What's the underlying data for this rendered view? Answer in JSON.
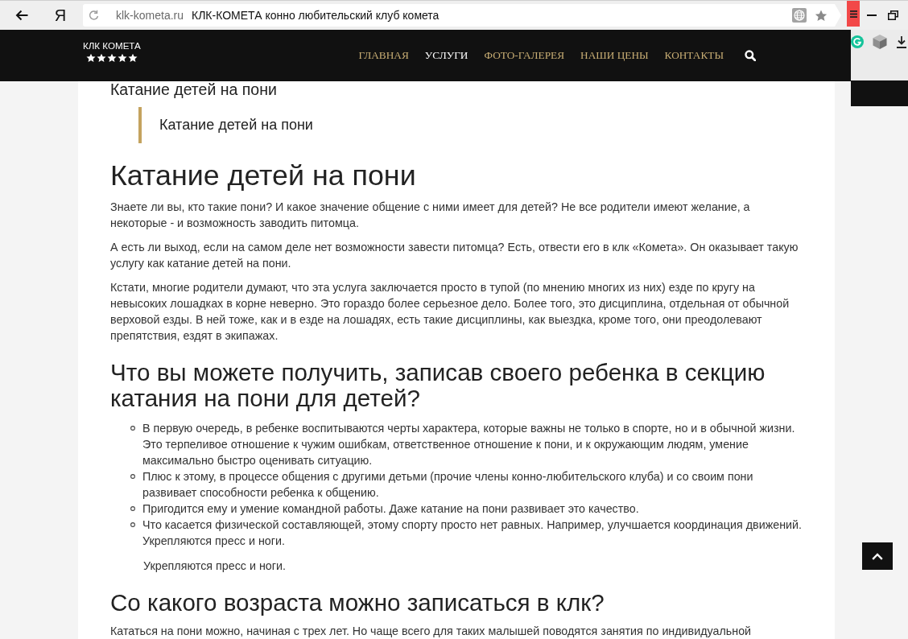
{
  "browser": {
    "logo": "Я",
    "domain": "klk-kometa.ru",
    "page_title": "КЛК-КОМЕТА конно любительский клуб комета"
  },
  "site_header": {
    "logo": {
      "name": "КЛК КОМЕТА",
      "stars": 5
    },
    "menu": [
      {
        "label": "ГЛАВНАЯ",
        "selected": false
      },
      {
        "label": "УСЛУГИ",
        "selected": true
      },
      {
        "label": "ФОТО-ГАЛЕРЕЯ",
        "selected": false
      },
      {
        "label": "НАШИ ЦЕНЫ",
        "selected": false
      },
      {
        "label": "КОНТАКТЫ",
        "selected": false
      }
    ]
  },
  "article": [
    {
      "kind": "subtitle",
      "text": "Катание детей на пони"
    },
    {
      "kind": "quote",
      "text": "Катание детей на пони"
    },
    {
      "kind": "title",
      "text": "Катание детей на пони"
    },
    {
      "kind": "paragraph",
      "text": "Знаете ли вы, кто такие пони? И какое значение общение с ними имеет для детей? Не все родители имеют желание, а некоторые - и возможность заводить питомца."
    },
    {
      "kind": "paragraph",
      "text": "А есть ли выход, если на самом деле нет возможности завести питомца? Есть, отвести его в клк «Комета». Он оказывает такую услугу как катание детей на пони."
    },
    {
      "kind": "paragraph",
      "text": "Кстати, многие родители думают, что эта услуга заключается просто в тупой (по мнению многих из них) езде по кругу на невысоких лошадках в корне неверно. Это гораздо более серьезное дело. Более того, это дисциплина, отдельная от обычной верховой езды. В ней тоже, как и в езде на лошадях, есть такие дисциплины, как выездка, кроме того, они преодолевают препятствия, ездят в экипажах."
    },
    {
      "kind": "heading",
      "text": "Что вы можете получить, записав своего ребенка в секцию катания на пони для детей?"
    },
    {
      "kind": "list",
      "items": [
        "В первую очередь, в ребенке воспитываются черты характера, которые важны не только в спорте, но и в обычной жизни. Это терпеливое отношение к чужим ошибкам, ответственное отношение к пони, и к окружающим людям, умение максимально быстро оценивать ситуацию.",
        "Плюс к этому, в процессе общения с другими детьми (прочие члены конно-любительского клуба) и со своим пони развивает способности ребенка к общению.",
        "Пригодится ему и умение командной работы. Даже катание на пони развивает это качество.",
        "Что касается физической составляющей, этому спорту просто нет равных. Например, улучшается координация движений. Укрепляются пресс и ноги."
      ]
    },
    {
      "kind": "fragment",
      "text": "Укрепляются пресс и ноги."
    },
    {
      "kind": "heading",
      "text": "Со какого возраста можно записаться в клк?"
    },
    {
      "kind": "paragraph",
      "text": "Кататься на пони можно, начиная с трех лет. Но чаще всего для таких малышей поводятся занятия по индивидуальной"
    }
  ]
}
